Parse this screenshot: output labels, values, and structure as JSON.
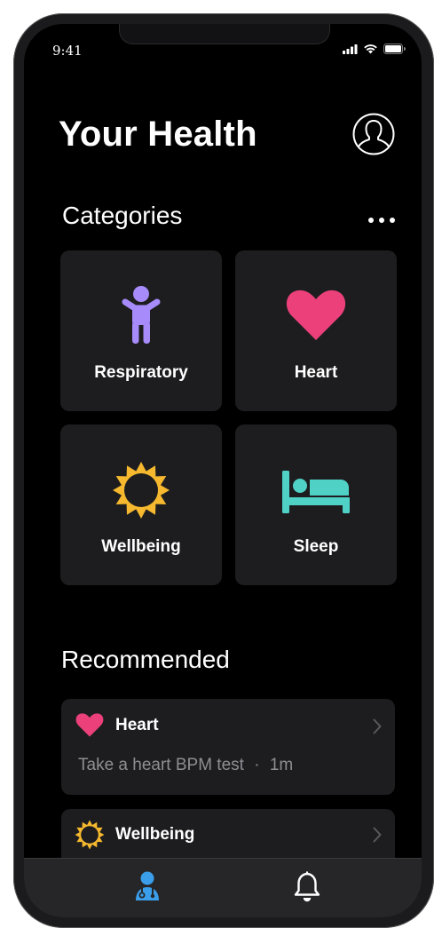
{
  "status_bar": {
    "time": "9:41"
  },
  "header": {
    "title": "Your Health"
  },
  "categories": {
    "heading": "Categories",
    "items": [
      {
        "label": "Respiratory",
        "icon": "person-icon",
        "color": "#a78bfa"
      },
      {
        "label": "Heart",
        "icon": "heart-icon",
        "color": "#ec407a"
      },
      {
        "label": "Wellbeing",
        "icon": "sun-icon",
        "color": "#f5b82e"
      },
      {
        "label": "Sleep",
        "icon": "bed-icon",
        "color": "#4fd1c5"
      }
    ]
  },
  "recommended": {
    "heading": "Recommended",
    "items": [
      {
        "title": "Heart",
        "subtitle": "Take a heart BPM test",
        "duration": "1m",
        "separator": "·",
        "icon": "heart-icon"
      },
      {
        "title": "Wellbeing",
        "icon": "sun-icon"
      }
    ]
  },
  "tabbar": {
    "tabs": [
      {
        "icon": "doctor-icon",
        "active": true,
        "color": "#3b9eea"
      },
      {
        "icon": "bell-icon",
        "active": false,
        "color": "#ffffff"
      }
    ]
  }
}
